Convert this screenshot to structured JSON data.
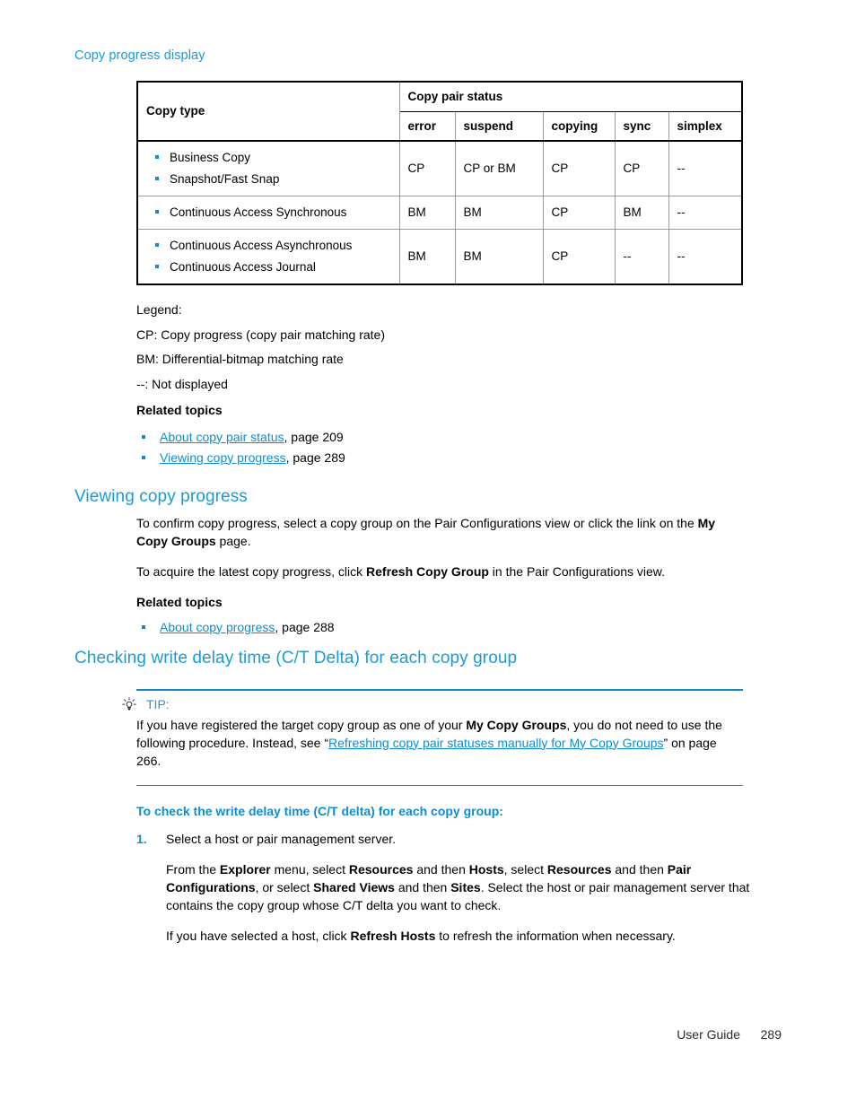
{
  "running_head": "Copy progress display",
  "table": {
    "col_header_group": "Copy pair status",
    "col_copy_type": "Copy type",
    "subheaders": [
      "error",
      "suspend",
      "copying",
      "sync",
      "simplex"
    ],
    "rows": [
      {
        "types": [
          "Business Copy",
          "Snapshot/Fast Snap"
        ],
        "values": [
          "CP",
          "CP or BM",
          "CP",
          "CP",
          "--"
        ]
      },
      {
        "types": [
          "Continuous Access Synchronous"
        ],
        "values": [
          "BM",
          "BM",
          "CP",
          "BM",
          "--"
        ]
      },
      {
        "types": [
          "Continuous Access Asynchronous",
          "Continuous Access Journal"
        ],
        "values": [
          "BM",
          "BM",
          "CP",
          "--",
          "--"
        ]
      }
    ]
  },
  "legend": {
    "title": "Legend:",
    "lines": [
      "CP: Copy progress (copy pair matching rate)",
      "BM: Differential-bitmap matching rate",
      "--: Not displayed"
    ],
    "related_topics_label": "Related topics",
    "links": [
      {
        "text": "About copy pair status",
        "suffix": ", page 209"
      },
      {
        "text": "Viewing copy progress",
        "suffix": ", page 289"
      }
    ]
  },
  "section_viewing": {
    "heading": "Viewing copy progress",
    "p1_a": "To confirm copy progress, select a copy group on the Pair Configurations view or click the link on the ",
    "p1_b": "My Copy Groups",
    "p1_c": " page.",
    "p2_a": "To acquire the latest copy progress, click ",
    "p2_b": "Refresh Copy Group",
    "p2_c": " in the Pair Configurations view.",
    "related_topics_label": "Related topics",
    "link_text": "About copy progress",
    "link_suffix": ", page 288"
  },
  "section_checking": {
    "heading": "Checking write delay time (C/T Delta) for each copy group",
    "tip": {
      "icon": "lightbulb-icon",
      "label": "TIP:",
      "a": "If you have registered the target copy group as one of your ",
      "b_bold": "My Copy Groups",
      "c": ", you do not need to use the following procedure. Instead, see “",
      "d_link": "Refreshing copy pair statuses manually for My Copy Groups",
      "e": "” on page 266."
    },
    "procedure_title": "To check the write delay time (C/T delta) for each copy group:",
    "steps": [
      {
        "num": "1.",
        "p1": "Select a host or pair management server.",
        "p2_parts": [
          {
            "t": "From the ",
            "bold": false
          },
          {
            "t": "Explorer",
            "bold": true
          },
          {
            "t": " menu, select ",
            "bold": false
          },
          {
            "t": "Resources",
            "bold": true
          },
          {
            "t": " and then ",
            "bold": false
          },
          {
            "t": "Hosts",
            "bold": true
          },
          {
            "t": ", select ",
            "bold": false
          },
          {
            "t": "Resources",
            "bold": true
          },
          {
            "t": " and then ",
            "bold": false
          },
          {
            "t": "Pair Configurations",
            "bold": true
          },
          {
            "t": ", or select ",
            "bold": false
          },
          {
            "t": "Shared Views",
            "bold": true
          },
          {
            "t": " and then ",
            "bold": false
          },
          {
            "t": "Sites",
            "bold": true
          },
          {
            "t": ". Select the host or pair management server that contains the copy group whose C/T delta you want to check.",
            "bold": false
          }
        ],
        "p3_a": "If you have selected a host, click ",
        "p3_b": "Refresh Hosts",
        "p3_c": " to refresh the information when necessary."
      }
    ]
  },
  "footer": {
    "guide": "User Guide",
    "page": "289"
  },
  "colors": {
    "heading_blue": "#1a9bd7",
    "link_blue": "#0d8dd0",
    "rule_blue": "#1a86c8",
    "table_frame": "#000000",
    "table_grid": "#9a9a9a"
  }
}
